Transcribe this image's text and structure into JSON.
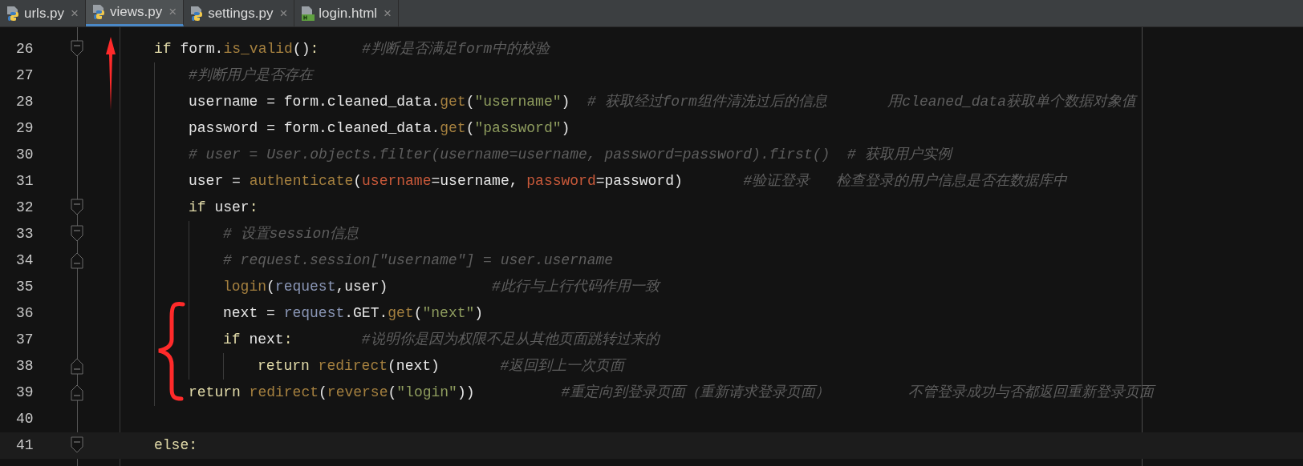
{
  "tabs": [
    {
      "label": "urls.py",
      "kind": "python",
      "selected": false,
      "close": "×"
    },
    {
      "label": "views.py",
      "kind": "python",
      "selected": true,
      "close": "×"
    },
    {
      "label": "settings.py",
      "kind": "python",
      "selected": false,
      "close": "×"
    },
    {
      "label": "login.html",
      "kind": "html",
      "selected": false,
      "close": "×"
    }
  ],
  "lines": [
    {
      "number": "26",
      "fold_open": true,
      "fold_close": false,
      "current": false,
      "tokens": [
        {
          "kind": "keyword",
          "text": "if"
        },
        {
          "kind": "plain",
          "text": " form."
        },
        {
          "kind": "function",
          "text": "is_valid"
        },
        {
          "kind": "plain",
          "text": "()"
        },
        {
          "kind": "keyword",
          "text": ":"
        },
        {
          "kind": "comment",
          "text": "     #判断是否满足form中的校验"
        }
      ],
      "children": [
        {
          "number": "27",
          "fold_open": false,
          "fold_close": false,
          "current": false,
          "tokens": [
            {
              "kind": "comment",
              "text": "#判断用户是否存在"
            }
          ]
        },
        {
          "number": "28",
          "fold_open": false,
          "fold_close": false,
          "current": false,
          "tokens": [
            {
              "kind": "plain",
              "text": "username = form.cleaned_data."
            },
            {
              "kind": "function",
              "text": "get"
            },
            {
              "kind": "plain",
              "text": "("
            },
            {
              "kind": "string",
              "text": "\"username\""
            },
            {
              "kind": "plain",
              "text": ")"
            },
            {
              "kind": "comment",
              "text": "  # 获取经过form组件清洗过后的信息       用cleaned_data获取单个数据对象值"
            }
          ]
        },
        {
          "number": "29",
          "fold_open": false,
          "fold_close": false,
          "current": false,
          "tokens": [
            {
              "kind": "plain",
              "text": "password = form.cleaned_data."
            },
            {
              "kind": "function",
              "text": "get"
            },
            {
              "kind": "plain",
              "text": "("
            },
            {
              "kind": "string",
              "text": "\"password\""
            },
            {
              "kind": "plain",
              "text": ")"
            }
          ]
        },
        {
          "number": "30",
          "fold_open": false,
          "fold_close": false,
          "current": false,
          "tokens": [
            {
              "kind": "comment",
              "text": "# user = User.objects.filter(username=username, password=password).first()  # 获取用户实例"
            }
          ]
        },
        {
          "number": "31",
          "fold_open": false,
          "fold_close": false,
          "current": false,
          "tokens": [
            {
              "kind": "plain",
              "text": "user = "
            },
            {
              "kind": "function",
              "text": "authenticate"
            },
            {
              "kind": "plain",
              "text": "("
            },
            {
              "kind": "param",
              "text": "username"
            },
            {
              "kind": "plain",
              "text": "=username, "
            },
            {
              "kind": "param",
              "text": "password"
            },
            {
              "kind": "plain",
              "text": "=password)"
            },
            {
              "kind": "comment",
              "text": "       #验证登录   检查登录的用户信息是否在数据库中"
            }
          ]
        },
        {
          "number": "32",
          "fold_open": true,
          "fold_close": false,
          "current": false,
          "tokens": [
            {
              "kind": "keyword",
              "text": "if"
            },
            {
              "kind": "plain",
              "text": " user"
            },
            {
              "kind": "keyword",
              "text": ":"
            }
          ],
          "children": [
            {
              "number": "33",
              "fold_open": true,
              "fold_close": false,
              "current": false,
              "tokens": [
                {
                  "kind": "comment",
                  "text": "# 设置session信息"
                }
              ]
            },
            {
              "number": "34",
              "fold_open": false,
              "fold_close": true,
              "current": false,
              "tokens": [
                {
                  "kind": "comment",
                  "text": "# request.session[\"username\"] = user.username"
                }
              ]
            },
            {
              "number": "35",
              "fold_open": false,
              "fold_close": false,
              "current": false,
              "tokens": [
                {
                  "kind": "function",
                  "text": "login"
                },
                {
                  "kind": "plain",
                  "text": "("
                },
                {
                  "kind": "object",
                  "text": "request"
                },
                {
                  "kind": "plain",
                  "text": ",user)"
                },
                {
                  "kind": "comment",
                  "text": "            #此行与上行代码作用一致"
                }
              ]
            },
            {
              "number": "36",
              "fold_open": false,
              "fold_close": false,
              "current": false,
              "tokens": [
                {
                  "kind": "plain",
                  "text": "next = "
                },
                {
                  "kind": "object",
                  "text": "request"
                },
                {
                  "kind": "plain",
                  "text": ".GET."
                },
                {
                  "kind": "function",
                  "text": "get"
                },
                {
                  "kind": "plain",
                  "text": "("
                },
                {
                  "kind": "string",
                  "text": "\"next\""
                },
                {
                  "kind": "plain",
                  "text": ")"
                }
              ]
            },
            {
              "number": "37",
              "fold_open": false,
              "fold_close": false,
              "current": false,
              "tokens": [
                {
                  "kind": "keyword",
                  "text": "if"
                },
                {
                  "kind": "plain",
                  "text": " next"
                },
                {
                  "kind": "keyword",
                  "text": ":"
                },
                {
                  "kind": "comment",
                  "text": "        #说明你是因为权限不足从其他页面跳转过来的"
                }
              ],
              "children": [
                {
                  "number": "38",
                  "fold_open": false,
                  "fold_close": true,
                  "current": false,
                  "tokens": [
                    {
                      "kind": "keyword",
                      "text": "return"
                    },
                    {
                      "kind": "function",
                      "text": " redirect"
                    },
                    {
                      "kind": "plain",
                      "text": "(next)"
                    },
                    {
                      "kind": "comment",
                      "text": "       #返回到上一次页面"
                    }
                  ]
                }
              ]
            }
          ]
        },
        {
          "number": "39",
          "fold_open": false,
          "fold_close": true,
          "current": false,
          "tokens": [
            {
              "kind": "keyword",
              "text": "return"
            },
            {
              "kind": "function",
              "text": " redirect"
            },
            {
              "kind": "plain",
              "text": "("
            },
            {
              "kind": "function",
              "text": "reverse"
            },
            {
              "kind": "plain",
              "text": "("
            },
            {
              "kind": "string",
              "text": "\"login\""
            },
            {
              "kind": "plain",
              "text": "))"
            },
            {
              "kind": "comment",
              "text": "          #重定向到登录页面（重新请求登录页面）         不管登录成功与否都返回重新登录页面"
            }
          ]
        }
      ]
    },
    {
      "number": "40",
      "fold_open": false,
      "fold_close": false,
      "current": false
    },
    {
      "number": "41",
      "fold_open": true,
      "fold_close": false,
      "current": true,
      "tokens": [
        {
          "kind": "keyword",
          "text": "else"
        },
        {
          "kind": "keyword",
          "text": ":"
        }
      ]
    }
  ]
}
